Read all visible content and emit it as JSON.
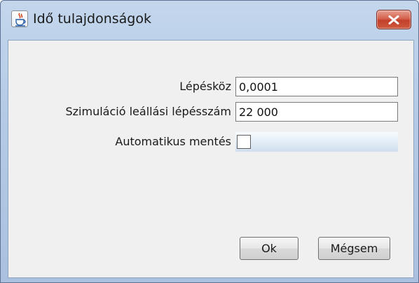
{
  "window": {
    "title": "Idő tulajdonságok",
    "close_icon": "close-icon",
    "app_icon": "java-coffee-icon"
  },
  "form": {
    "step_label": "Lépésköz",
    "step_value": "0,0001",
    "stop_label": "Szimuláció leállási lépésszám",
    "stop_value": "22 000",
    "autosave_label": "Automatikus mentés",
    "autosave_checked": false
  },
  "buttons": {
    "ok_label": "Ok",
    "cancel_label": "Mégsem"
  },
  "colors": {
    "titlebar": "#b4cbe6",
    "close_button": "#c2402a",
    "panel": "#f0f0f0"
  }
}
